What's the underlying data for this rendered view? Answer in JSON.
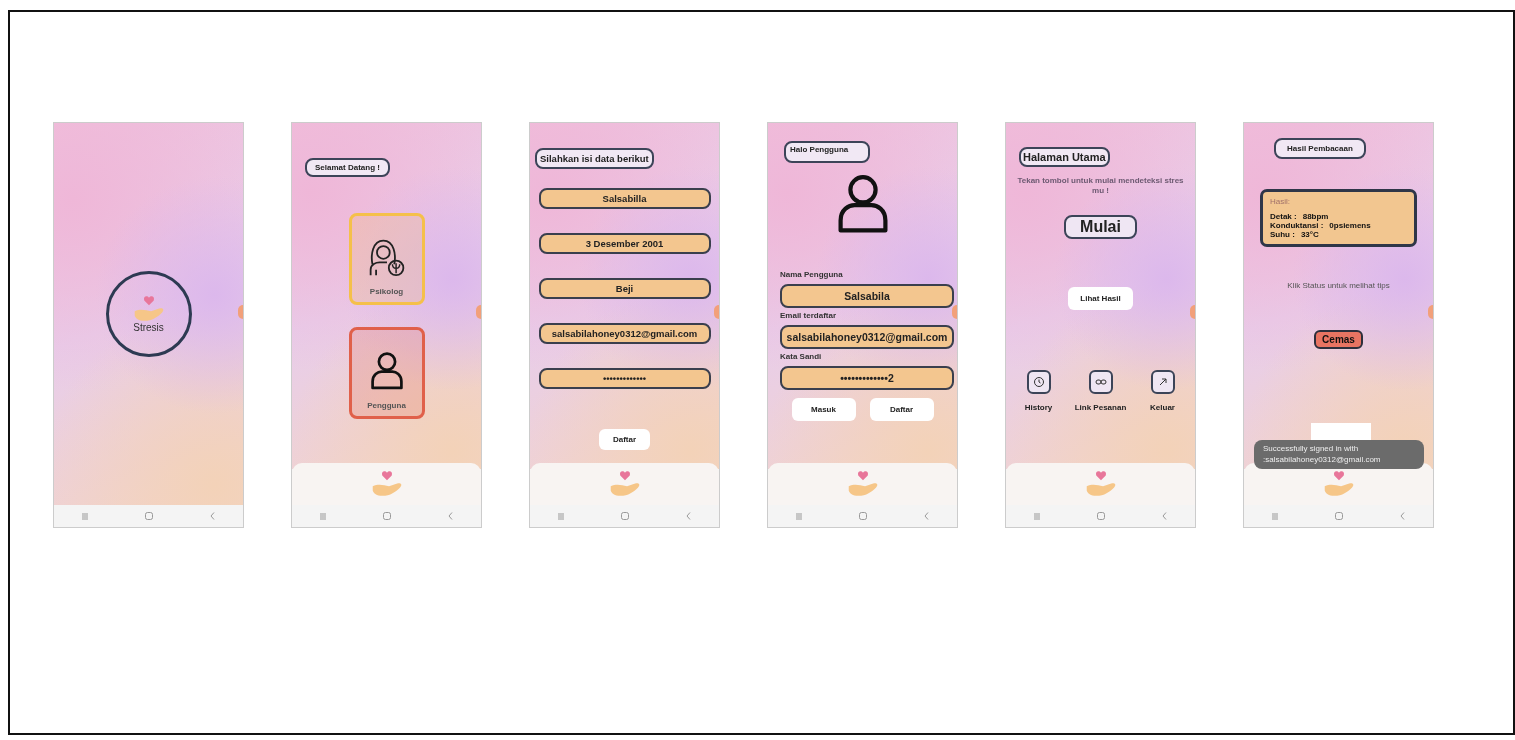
{
  "screens": [
    {
      "kind": "splash",
      "logo_title": "Stresis"
    },
    {
      "kind": "role",
      "title": "Selamat Datang !",
      "options": [
        {
          "label": "Psikolog",
          "color": "#f5c04a"
        },
        {
          "label": "Pengguna",
          "color": "#e0604a"
        }
      ]
    },
    {
      "kind": "register",
      "title": "Silahkan isi data berikut",
      "fields": [
        {
          "value": "Salsabilla"
        },
        {
          "value": "3 Desember 2001"
        },
        {
          "value": "Beji"
        },
        {
          "value": "salsabilahoney0312@gmail.com"
        },
        {
          "value": "•••••••••••••"
        }
      ],
      "button": "Daftar"
    },
    {
      "kind": "login",
      "title": "Halo Pengguna",
      "fields": [
        {
          "label": "Nama Pengguna",
          "value": "Salsabila"
        },
        {
          "label": "Email terdaftar",
          "value": "salsabilahoney0312@gmail.com"
        },
        {
          "label": "Kata Sandi",
          "value": "•••••••••••••2"
        }
      ],
      "buttons": [
        "Masuk",
        "Daftar"
      ]
    },
    {
      "kind": "home",
      "title": "Halaman Utama",
      "instruction": "Tekan tombol untuk mulai mendeteksi stres mu !",
      "start_button": "Mulai",
      "result_button": "Lihat Hasil",
      "actions": [
        {
          "label": "History"
        },
        {
          "label": "Link Pesanan"
        },
        {
          "label": "Keluar"
        }
      ]
    },
    {
      "kind": "result",
      "title": "Hasil Pembacaan",
      "result_heading": "Hasil:",
      "readings": [
        {
          "label": "Detak :",
          "value": "88bpm"
        },
        {
          "label": "Konduktansi :",
          "value": "0psiemens"
        },
        {
          "label": "Suhu :",
          "value": "33°C"
        }
      ],
      "hint": "Klik Status untuk melihat tips",
      "status": "Cemas",
      "toast": "Successfully signed in with :salsabilahoney0312@gmail.com"
    }
  ]
}
